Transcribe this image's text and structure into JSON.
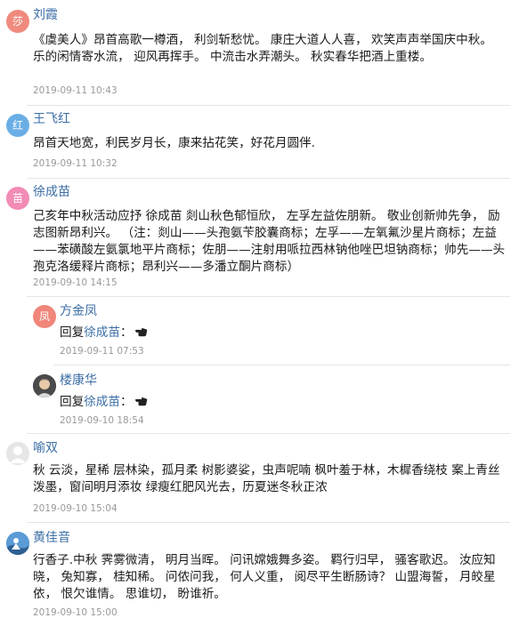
{
  "comments": [
    {
      "avatar_char": "莎",
      "avatar_color": "#f08a7e",
      "name": "刘霞",
      "text": "《虞美人》昂首高歌一樽酒， 利剑斩愁忧。 康庄大道人人喜， 欢笑声声举国庆中秋。 乐的闲情寄水流， 迎风再挥手。 中流击水弄潮头。 秋实春华把酒上重楼。",
      "time": "2019-09-11 10:43"
    },
    {
      "avatar_char": "红",
      "avatar_color": "#6aaee6",
      "name": "王飞红",
      "text": "昂首天地宽，利民岁月长，康来拈花笑，好花月圆伴.",
      "time": "2019-09-11 10:32"
    },
    {
      "avatar_char": "苗",
      "avatar_color": "#f28bb5",
      "name": "徐成苗",
      "text": "己亥年中秋活动应抒 徐成苗 剡山秋色郁恒欣， 左孚左益佐朋新。 敬业创新帅先争， 励志图新昂利兴。 （注：剡山——头孢氨苄胶囊商标；左孚——左氧氟沙星片商标；左益——苯磺酸左氨氯地平片商标；佐朋——注射用哌拉西林钠他唑巴坦钠商标；帅先——头孢克洛缓释片商标；昂利兴——多潘立酮片商标）",
      "time": "2019-09-10 14:15"
    },
    {
      "avatar_char": "凤",
      "avatar_color": "#f0857a",
      "name": "方金凤",
      "reply_prefix": "回复",
      "reply_target": "徐成苗",
      "reply_colon": "：",
      "time": "2019-09-11 07:53"
    },
    {
      "avatar_char": "",
      "avatar_color": "#3a3a3a",
      "name": "楼康华",
      "reply_prefix": "回复",
      "reply_target": "徐成苗",
      "reply_colon": "：",
      "time": "2019-09-10 18:54"
    },
    {
      "avatar_char": "",
      "avatar_color": "#e3e3e3",
      "name": "喻双",
      "text": "秋 云淡，星稀 层林染，孤月柔 树影婆娑，虫声呢喃 枫叶羞于林，木樨香绕枝 案上青丝泼墨，窗间明月添妆 绿瘦红肥风光去，历夏迷冬秋正浓",
      "time": "2019-09-10 15:04"
    },
    {
      "avatar_char": "",
      "avatar_color": "#4a88c7",
      "name": "黄佳音",
      "text": "行香子.中秋 霁雾微清， 明月当晖。 问讯嫦娥舞多姿。 羁行归早， 骚客歌迟。 汝应知晓， 兔知寡， 桂知稀。 问侬问我， 何人义重， 阅尽平生断肠诗？ 山盟海誓， 月皎星依， 恨欠谁情。 思谁切， 盼谁祈。",
      "time": "2019-09-10 15:00"
    }
  ]
}
